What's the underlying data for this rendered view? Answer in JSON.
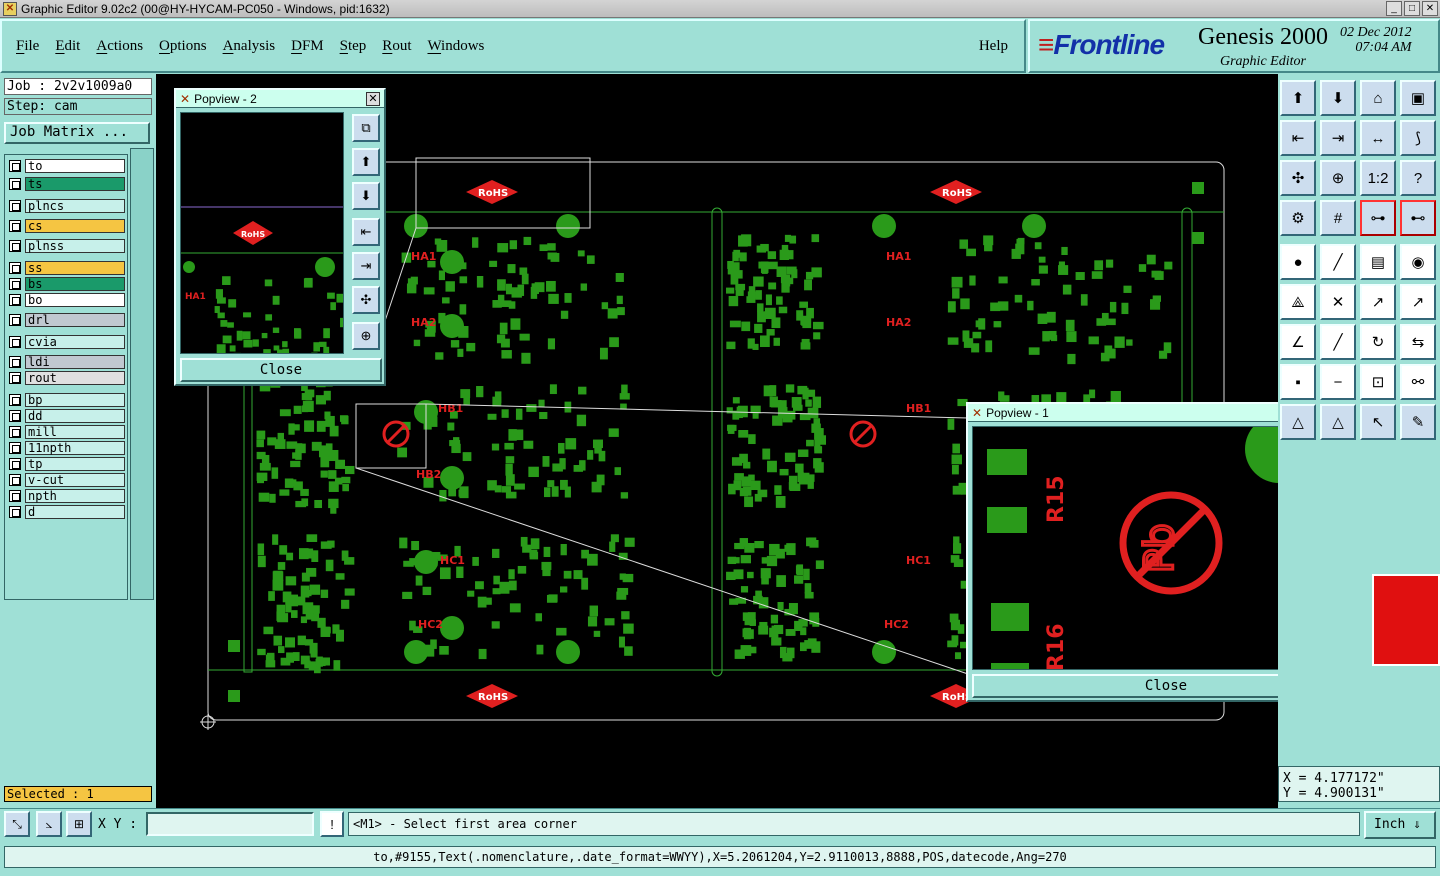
{
  "window": {
    "title": "Graphic Editor 9.02c2 (00@HY-HYCAM-PC050 - Windows, pid:1632)"
  },
  "menu": [
    "File",
    "Edit",
    "Actions",
    "Options",
    "Analysis",
    "DFM",
    "Step",
    "Rout",
    "Windows"
  ],
  "help": "Help",
  "brand": {
    "logo_text": "Frontline",
    "product": "Genesis 2000",
    "subtitle": "Graphic Editor",
    "date_line1": "02  Dec  2012",
    "date_line2": "07:04  AM"
  },
  "job": {
    "job": "Job : 2v2v1009a0",
    "step": "Step: cam",
    "matrix_button": "Job Matrix ..."
  },
  "layers": [
    {
      "name": "to",
      "color": "#ffffff"
    },
    {
      "name": "ts",
      "color": "#1a9a6a"
    },
    {
      "name": "plncs",
      "color": "#c7f0ea"
    },
    {
      "name": "cs",
      "color": "#f5c542"
    },
    {
      "name": "plnss",
      "color": "#c7f0ea"
    },
    {
      "name": "ss",
      "color": "#f5c542"
    },
    {
      "name": "bs",
      "color": "#1a9a6a"
    },
    {
      "name": "bo",
      "color": "#ffffff"
    },
    {
      "name": "drl",
      "color": "#c0c8d0"
    },
    {
      "name": "cvia",
      "color": "#c7f0ea"
    },
    {
      "name": "ldi",
      "color": "#c0c8d0"
    },
    {
      "name": "rout",
      "color": "#e0e0e0"
    },
    {
      "name": "bp",
      "color": "#c7f0ea"
    },
    {
      "name": "dd",
      "color": "#c7f0ea"
    },
    {
      "name": "mill",
      "color": "#c7f0ea"
    },
    {
      "name": "11npth",
      "color": "#c7f0ea"
    },
    {
      "name": "tp",
      "color": "#c7f0ea"
    },
    {
      "name": "v-cut",
      "color": "#c7f0ea"
    },
    {
      "name": "npth",
      "color": "#c7f0ea"
    },
    {
      "name": "d",
      "color": "#c7f0ea"
    }
  ],
  "selected": "Selected : 1",
  "popup2": {
    "title": "Popview - 2",
    "close": "Close"
  },
  "popup1": {
    "title": "Popview - 1",
    "close": "Close",
    "labels": [
      "R15",
      "R16"
    ]
  },
  "board_labels": [
    "RoHS",
    "RoHS",
    "RoHS",
    "RoHS",
    "HA1",
    "HA2",
    "HA1",
    "HA2",
    "HB1",
    "HB2",
    "HB1",
    "HC1",
    "HC2",
    "HC1",
    "HC2"
  ],
  "coords": {
    "x": "X = 4.177172\"",
    "y": "Y = 4.900131\""
  },
  "xy_label": "X Y :",
  "xy_value": "",
  "prompt": "<M1> - Select first area corner",
  "units": "Inch",
  "status": "to,#9155,Text(.nomenclature,.date_format=WWYY),X=5.2061204,Y=2.9110013,8888,POS,datecode,Ang=270"
}
